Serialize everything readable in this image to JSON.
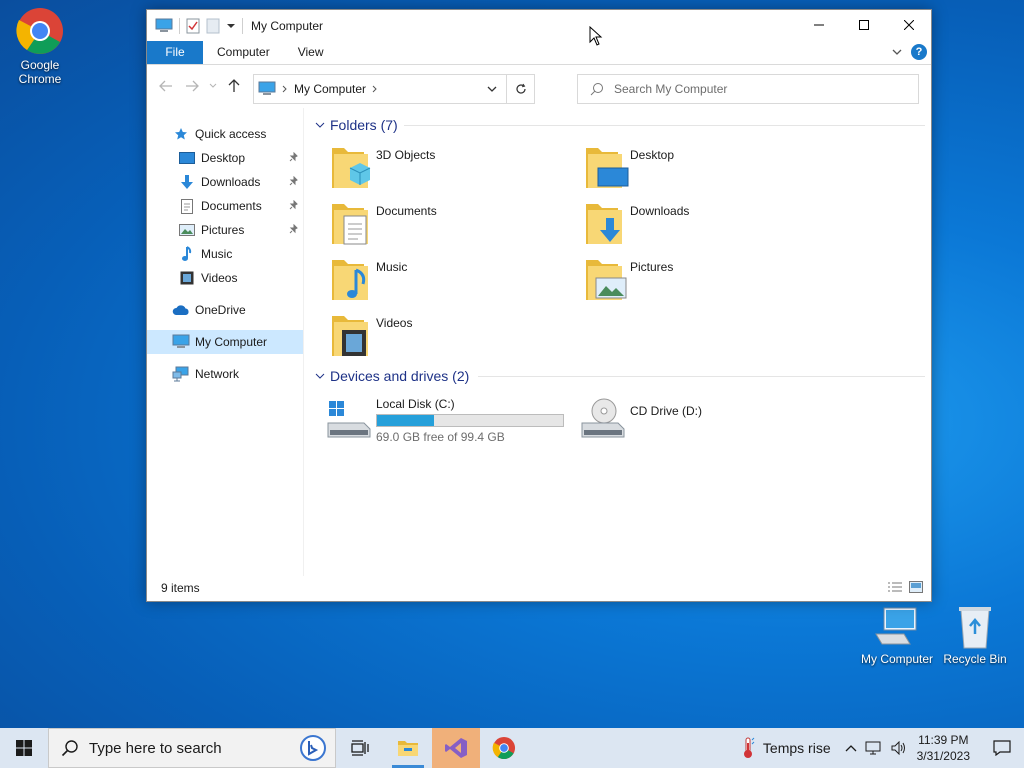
{
  "desktop": {
    "icons": [
      {
        "label_line1": "Google",
        "label_line2": "Chrome"
      },
      {
        "label_line1": "My Computer"
      },
      {
        "label_line1": "Recycle Bin"
      }
    ]
  },
  "window": {
    "title": "My Computer",
    "ribbon_tabs": [
      "File",
      "Computer",
      "View"
    ],
    "address": {
      "location": "My Computer"
    },
    "search_placeholder": "Search My Computer",
    "nav": {
      "quick_access": "Quick access",
      "quick_items": [
        "Desktop",
        "Downloads",
        "Documents",
        "Pictures",
        "Music",
        "Videos"
      ],
      "onedrive": "OneDrive",
      "my_computer": "My Computer",
      "network": "Network"
    },
    "folders_header": "Folders (7)",
    "folders": [
      "3D Objects",
      "Desktop",
      "Documents",
      "Downloads",
      "Music",
      "Pictures",
      "Videos"
    ],
    "drives_header": "Devices and drives (2)",
    "drives": [
      {
        "name": "Local Disk (C:)",
        "free_text": "69.0 GB free of 99.4 GB",
        "used_fraction": 0.306
      },
      {
        "name": "CD Drive (D:)"
      }
    ],
    "status": "9 items"
  },
  "taskbar": {
    "search_placeholder": "Type here to search",
    "weather": "Temps rise",
    "time": "11:39 PM",
    "date": "3/31/2023"
  },
  "colors": {
    "accent": "#1979ca",
    "selection": "#cce8ff",
    "folder_yellow": "#f5c542",
    "drive_bar": "#26a0da"
  }
}
